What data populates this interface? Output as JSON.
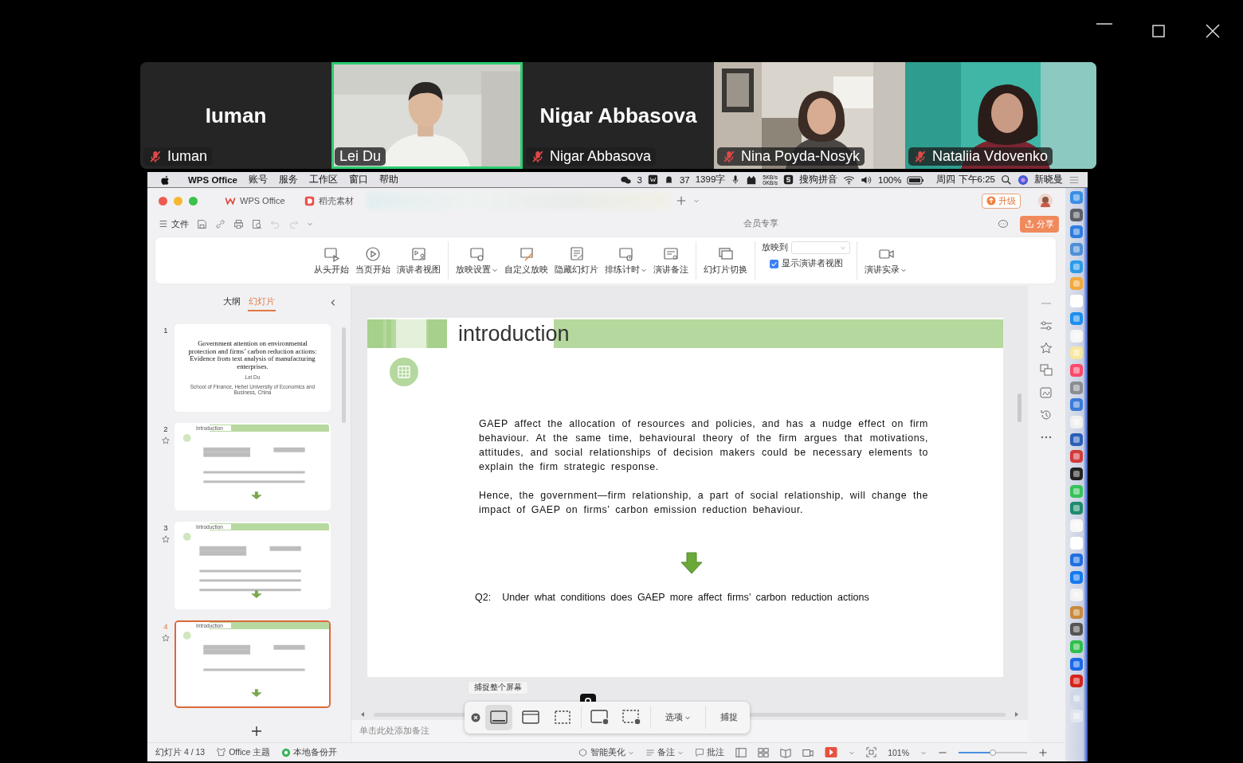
{
  "participants": [
    {
      "kind": "name_card",
      "display_name": "Iuman",
      "name": "Iuman",
      "muted": true,
      "selected": false
    },
    {
      "kind": "video",
      "name": "Lei Du",
      "muted": false,
      "selected": true
    },
    {
      "kind": "name_card",
      "display_name": "Nigar Abbasova",
      "name": "Nigar Abbasova",
      "muted": true,
      "selected": false
    },
    {
      "kind": "video",
      "name": "Nina Poyda-Nosyk",
      "muted": true,
      "selected": false
    },
    {
      "kind": "video",
      "name": "Nataliia Vdovenko",
      "muted": true,
      "selected": false
    }
  ],
  "menu_bar": {
    "app_name": "WPS Office",
    "menus": [
      "账号",
      "服务",
      "工作区",
      "窗口",
      "帮助"
    ],
    "wechat_count": "3",
    "qq_count": "37",
    "word_count": "1399字",
    "net_up": "5KB/s",
    "net_down": "0KB/s",
    "input_method": "搜狗拼音",
    "battery": "100%",
    "clock": "周四 下午6:25",
    "user": "新晓曼"
  },
  "tabs": [
    {
      "label": "WPS Office"
    },
    {
      "label": "稻壳素材"
    }
  ],
  "upgrade_button": "升级",
  "file_menu": "文件",
  "member_label": "会员专享",
  "share_button": "分享",
  "ribbon": {
    "groups": [
      [
        {
          "label": "从头开始",
          "dropdown": false
        },
        {
          "label": "当页开始",
          "dropdown": false
        },
        {
          "label": "演讲者视图",
          "dropdown": false
        }
      ],
      [
        {
          "label": "放映设置",
          "dropdown": true
        },
        {
          "label": "自定义放映",
          "dropdown": false
        },
        {
          "label": "隐藏幻灯片",
          "dropdown": false
        },
        {
          "label": "排练计时",
          "dropdown": true
        },
        {
          "label": "演讲备注",
          "dropdown": false
        }
      ],
      [
        {
          "label": "幻灯片切换",
          "dropdown": false
        }
      ]
    ],
    "project_to": "放映到",
    "presenter_view": {
      "label": "显示演讲者视图",
      "checked": true
    },
    "record": {
      "label": "演讲实录",
      "dropdown": true
    }
  },
  "slide_panel": {
    "tabs": [
      {
        "label": "大纲",
        "selected": false
      },
      {
        "label": "幻灯片",
        "selected": true
      }
    ],
    "slides": [
      {
        "number": "1",
        "kind": "title",
        "title": "Government attention on environmental protection and firms’ carbon reduction actions: Evidence from text analysis of manufacturing enterprises.",
        "author": "Lei Du",
        "affiliation": "School of Finance, Hebei University of Economics and Business, China",
        "selected": false
      },
      {
        "number": "2",
        "kind": "content",
        "header": "Introduction",
        "selected": false
      },
      {
        "number": "3",
        "kind": "content",
        "header": "Introduction",
        "selected": false
      },
      {
        "number": "4",
        "kind": "content",
        "header": "Introduction",
        "selected": true
      }
    ]
  },
  "slide": {
    "title": "introduction",
    "paragraphs": [
      "GAEP affect the allocation of resources and policies, and has a nudge effect on firm behaviour. At the same time, behavioural theory of the firm argues that motivations, attitudes, and social relationships of decision makers could be necessary elements to explain the firm strategic response.",
      "Hence, the government—firm relationship, a part of social relationship, will change the impact of GAEP on firms’ carbon emission reduction behaviour."
    ],
    "question_label": "Q2:",
    "question": "Under what conditions does GAEP more affect firms’ carbon reduction actions"
  },
  "notes_placeholder": "单击此处添加备注",
  "capture_toolbar": {
    "tooltip": "捕捉整个屏幕",
    "modes": [
      {
        "kind": "screen",
        "selected": true
      },
      {
        "kind": "window",
        "selected": false
      },
      {
        "kind": "selection",
        "selected": false
      },
      {
        "kind": "record_screen",
        "selected": false
      },
      {
        "kind": "record_selection",
        "selected": false
      }
    ],
    "options": "选项",
    "capture": "捕捉"
  },
  "status_bar": {
    "slide_counter": "幻灯片 4 / 13",
    "theme": "Office 主题",
    "backup": "本地备份开",
    "beautify": "智能美化",
    "notes": "备注",
    "comments": "批注",
    "zoom": "101%",
    "zoom_slider": {
      "level": 0.5
    }
  }
}
